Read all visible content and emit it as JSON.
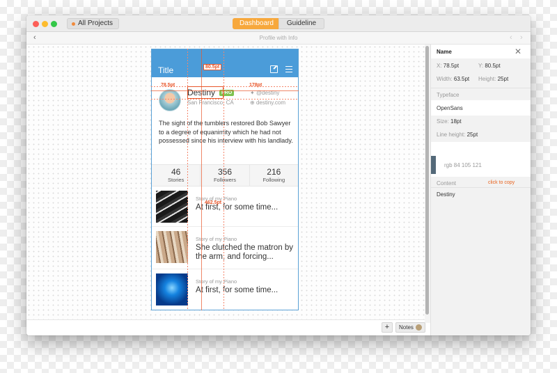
{
  "window": {
    "projects_label": "All Projects",
    "tabs": [
      {
        "label": "Dashboard"
      },
      {
        "label": "Guideline"
      }
    ],
    "page_title": "Profile with Info",
    "back_glyph": "‹",
    "prev_glyph": "‹",
    "next_glyph": "›"
  },
  "phone": {
    "title": "Title",
    "profile": {
      "name": "Destiny",
      "badge": "PRO",
      "location": "San Francisco, CA",
      "twitter": "@destiny",
      "website": "destiny.com"
    },
    "bio": "The sight of the tumblers restored Bob Sawyer to a degree of equanimity which he had not possessed since his interview with his landlady.",
    "stats": [
      {
        "value": "46",
        "label": "Stories"
      },
      {
        "value": "356",
        "label": "Followers"
      },
      {
        "value": "216",
        "label": "Following"
      }
    ],
    "stories": [
      {
        "overline": "Story of my Piano",
        "headline": "At first, for some time..."
      },
      {
        "overline": "Story of my Piano",
        "headline": "She clutched the matron by the arm, and forcing..."
      },
      {
        "overline": "Story of my Piano",
        "headline": "At first, for some time..."
      }
    ]
  },
  "measurements": {
    "top_gap": "80.5pt",
    "left_gap": "78.5pt",
    "right_gap": "178pt",
    "bottom_gap": "462.5pt"
  },
  "inspector": {
    "title": "Name",
    "x_label": "X:",
    "x_value": "78.5pt",
    "y_label": "Y:",
    "y_value": "80.5pt",
    "width_label": "Width:",
    "width_value": "63.5pt",
    "height_label": "Height:",
    "height_value": "25pt",
    "typeface_label": "Typeface",
    "typeface_value": "OpenSans",
    "size_label": "Size:",
    "size_value": "18pt",
    "lineheight_label": "Line height:",
    "lineheight_value": "25pt",
    "color_value": "rgb 84 105 121",
    "content_label": "Content",
    "copy_label": "click to copy",
    "content_value": "Destiny"
  },
  "bottom": {
    "plus": "+",
    "notes": "Notes"
  },
  "colors": {
    "accent_orange": "#f7a83c",
    "header_blue": "#4b9cd9",
    "measure_red": "#e8562a",
    "swatch": "#546979"
  }
}
